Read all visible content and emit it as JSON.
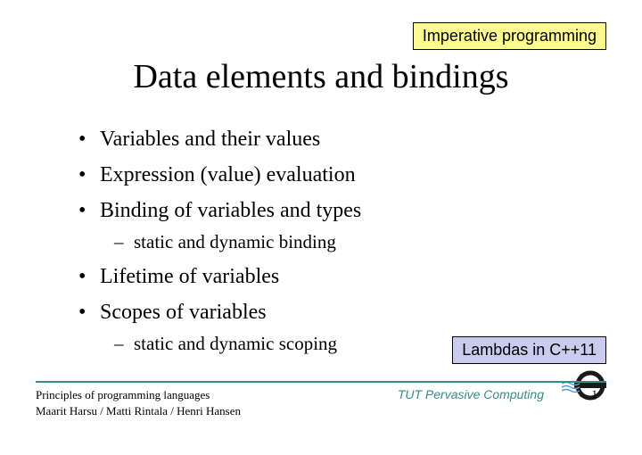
{
  "tags": {
    "yellow": "Imperative programming",
    "blue": "Lambdas in C++11"
  },
  "title": "Data elements and bindings",
  "bullets": [
    {
      "text": "Variables and their values"
    },
    {
      "text": "Expression (value) evaluation"
    },
    {
      "text": "Binding of variables and types",
      "sub": "static and dynamic binding"
    },
    {
      "text": "Lifetime of variables"
    },
    {
      "text": "Scopes of variables",
      "sub": "static and dynamic scoping"
    }
  ],
  "footer": {
    "course": "Principles of programming languages",
    "authors": "Maarit Harsu / Matti Rintala / Henri Hansen",
    "center": "TUT Pervasive Computing",
    "page": "1"
  }
}
